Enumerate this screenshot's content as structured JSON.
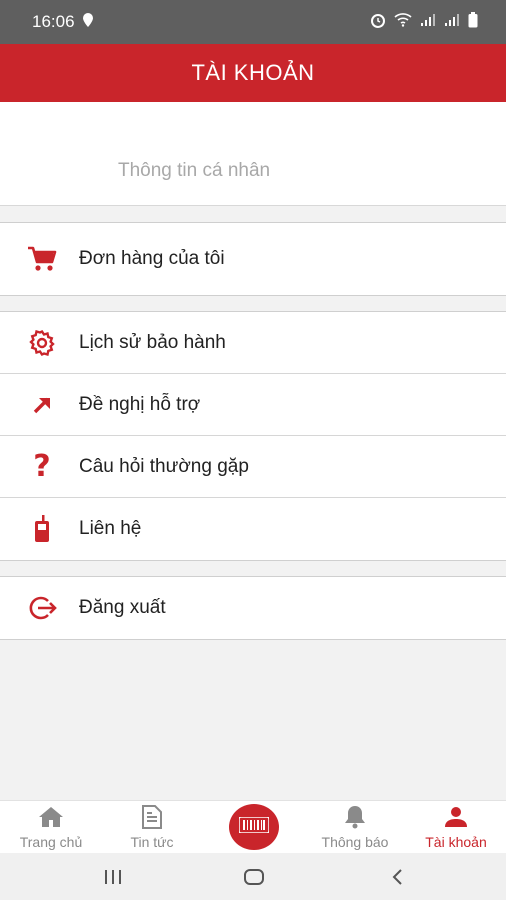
{
  "status_bar": {
    "time": "16:06"
  },
  "header": {
    "title": "TÀI KHOẢN"
  },
  "profile": {
    "label": "Thông tin cá nhân"
  },
  "groups": [
    {
      "items": [
        {
          "label": "Đơn hàng của tôi",
          "icon": "cart-icon"
        }
      ]
    },
    {
      "items": [
        {
          "label": "Lịch sử bảo hành",
          "icon": "gear-icon"
        },
        {
          "label": "Đề nghị hỗ trợ",
          "icon": "arrow-up-right-icon"
        },
        {
          "label": "Câu hỏi thường gặp",
          "icon": "question-icon"
        },
        {
          "label": "Liên hệ",
          "icon": "phone-icon"
        }
      ]
    },
    {
      "items": [
        {
          "label": "Đăng xuất",
          "icon": "logout-icon"
        }
      ]
    }
  ],
  "bottom_nav": {
    "items": [
      {
        "label": "Trang chủ",
        "icon": "home-icon"
      },
      {
        "label": "Tin tức",
        "icon": "news-icon"
      },
      {
        "label": "",
        "icon": "barcode-scan-icon"
      },
      {
        "label": "Thông báo",
        "icon": "bell-icon"
      },
      {
        "label": "Tài khoản",
        "icon": "user-icon",
        "active": true
      }
    ]
  },
  "colors": {
    "accent": "#c9252b",
    "status_bar": "#5f5f5f",
    "background": "#f2f2f2"
  }
}
